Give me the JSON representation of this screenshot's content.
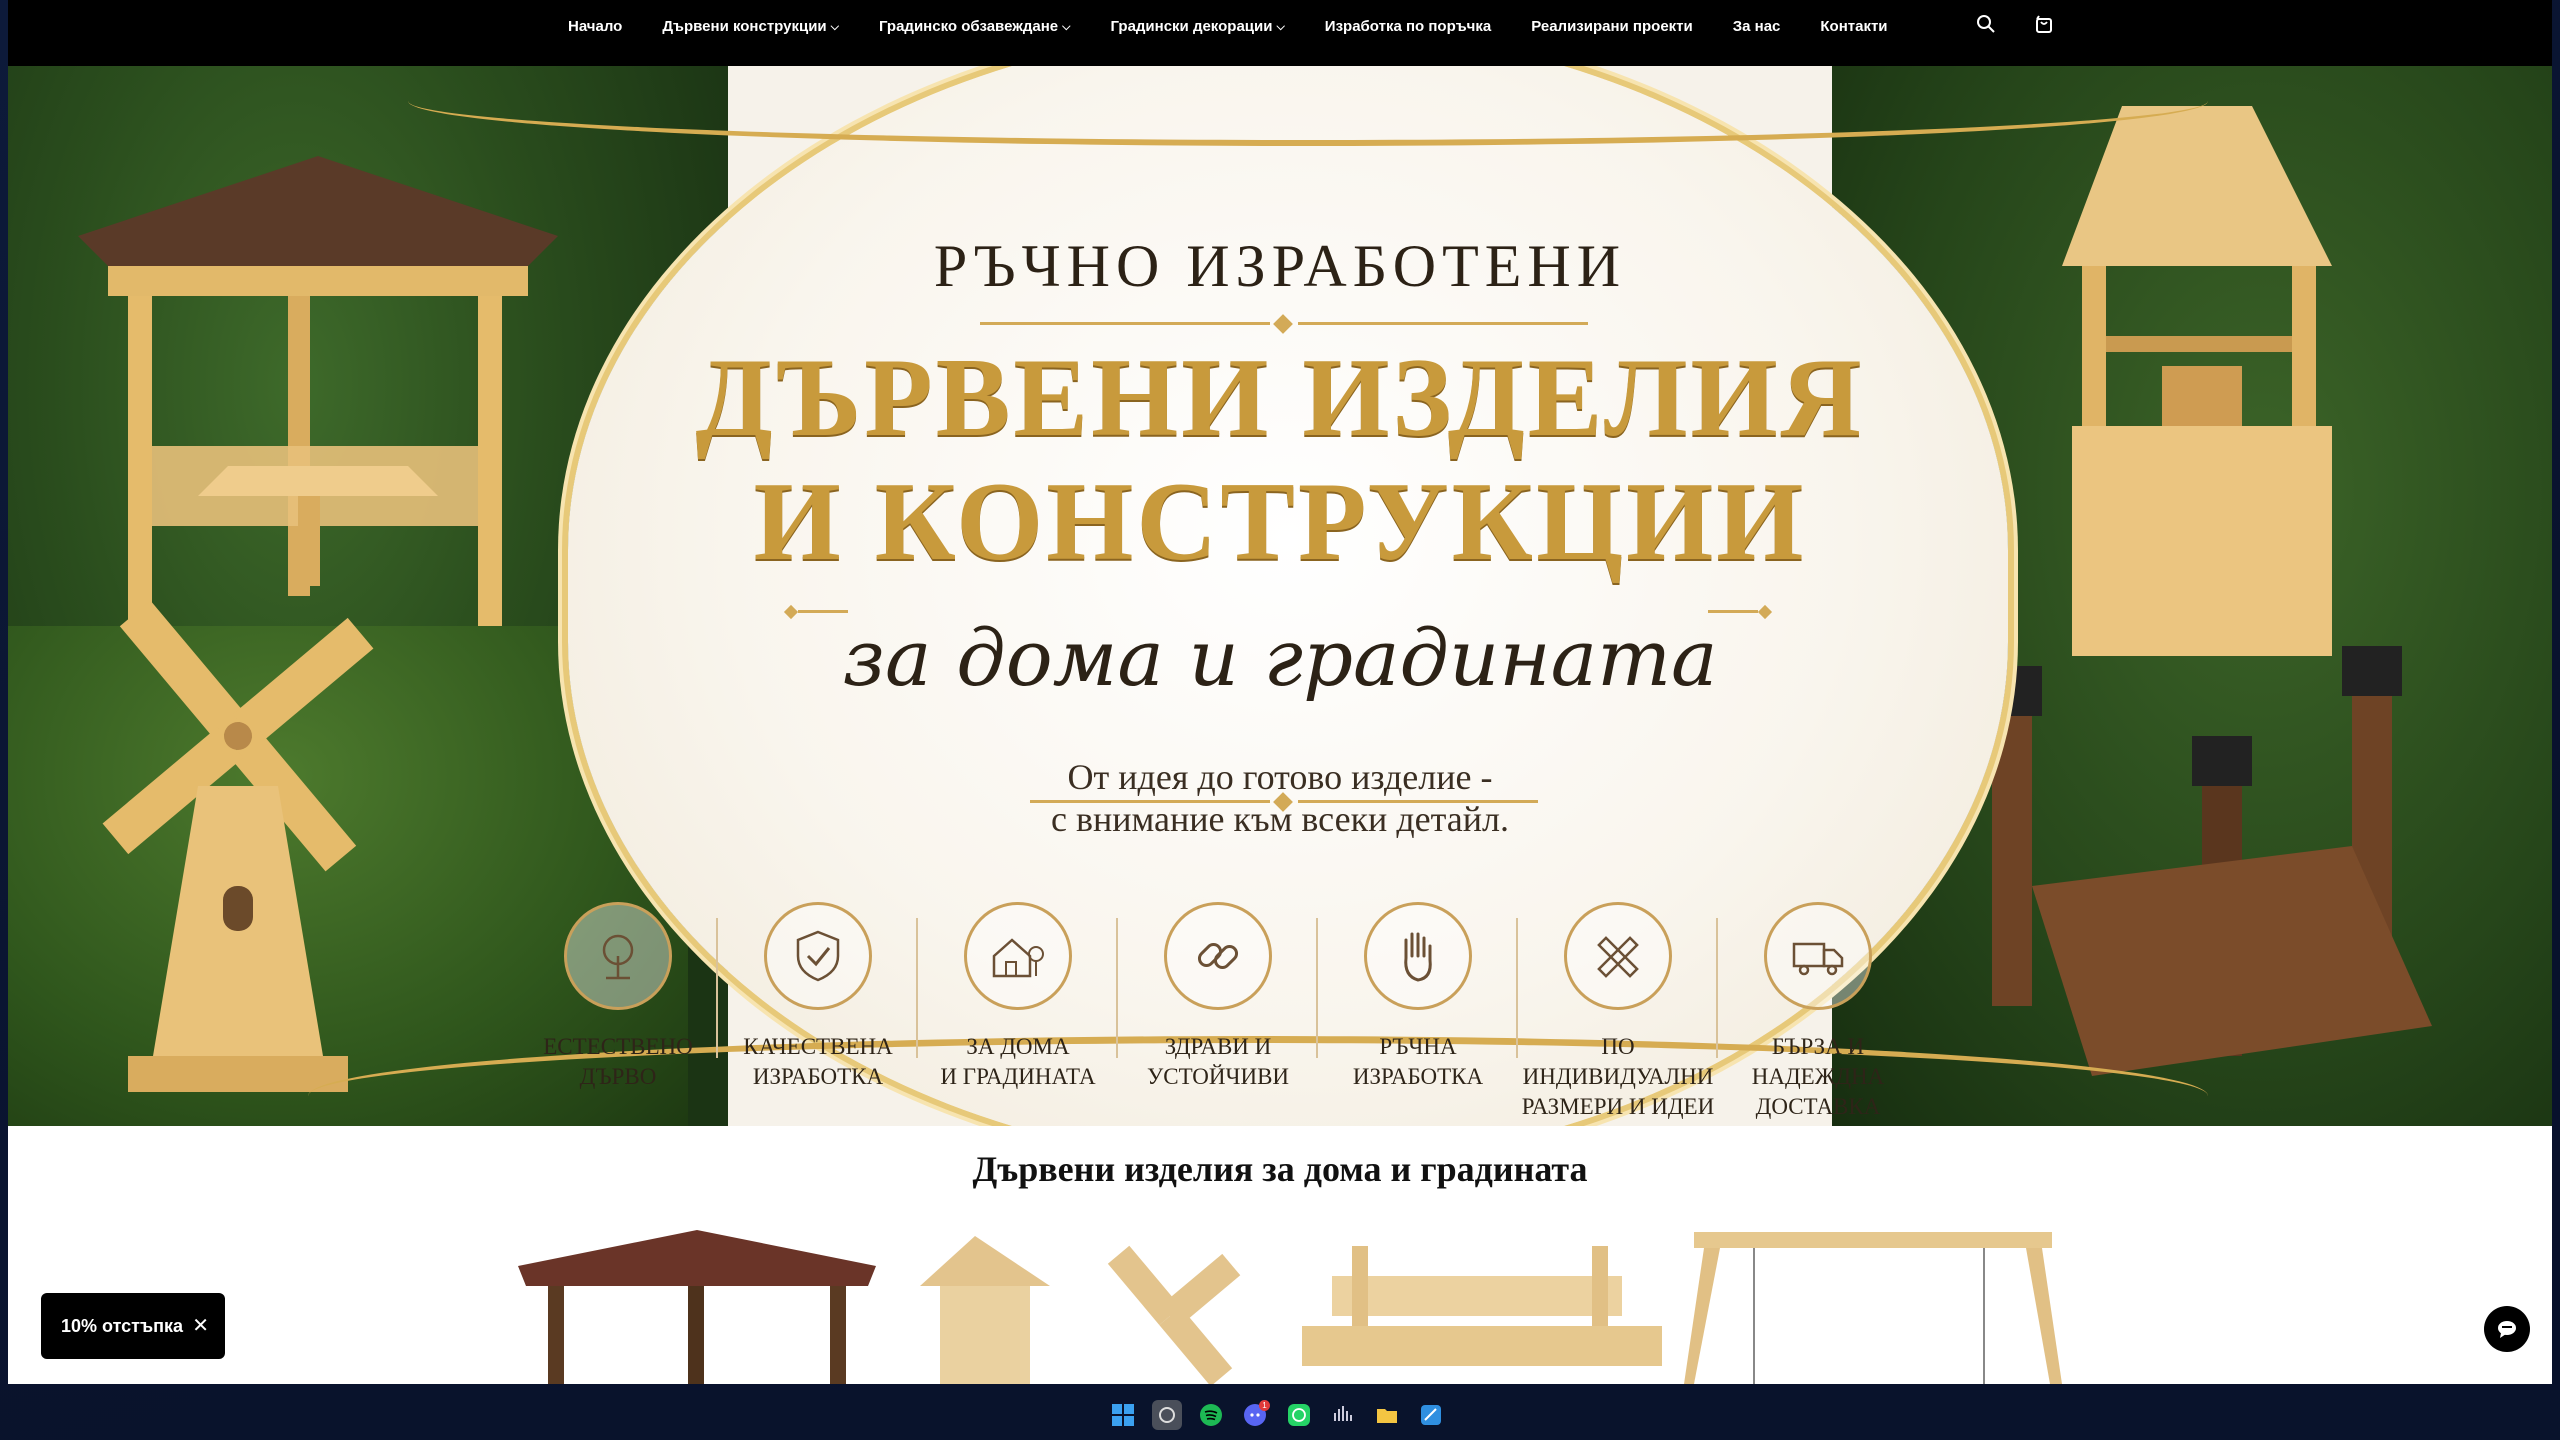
{
  "nav": {
    "items": [
      {
        "label": "Начало",
        "has_dropdown": false
      },
      {
        "label": "Дървени конструкции",
        "has_dropdown": true
      },
      {
        "label": "Градинско обзавеждане",
        "has_dropdown": true
      },
      {
        "label": "Градински декорации",
        "has_dropdown": true
      },
      {
        "label": "Изработка по поръчка",
        "has_dropdown": false
      },
      {
        "label": "Реализирани проекти",
        "has_dropdown": false
      },
      {
        "label": "За нас",
        "has_dropdown": false
      },
      {
        "label": "Контакти",
        "has_dropdown": false
      }
    ],
    "icons": [
      "search-icon",
      "cart-icon"
    ]
  },
  "hero": {
    "title_small": "РЪЧНО ИЗРАБОТЕНИ",
    "title_line1": "ДЪРВЕНИ ИЗДЕЛИЯ",
    "title_line2": "И КОНСТРУКЦИИ",
    "title_script": "за дома и градината",
    "subtitle_line1": "От идея до готово изделие -",
    "subtitle_line2": "с внимание към всеки детайл.",
    "features": [
      {
        "icon": "tree-icon",
        "label": "ЕСТЕСТВЕНО\nДЪРВО"
      },
      {
        "icon": "shield-check-icon",
        "label": "КАЧЕСТВЕНА\nИЗРАБОТКА"
      },
      {
        "icon": "house-tree-icon",
        "label": "ЗА ДОМА\nИ ГРАДИНАТА"
      },
      {
        "icon": "chain-link-icon",
        "label": "ЗДРАВИ И\nУСТОЙЧИВИ"
      },
      {
        "icon": "hand-icon",
        "label": "РЪЧНА\nИЗРАБОТКА"
      },
      {
        "icon": "ruler-pencil-icon",
        "label": "ПО ИНДИВИДУАЛНИ\nРАЗМЕРИ И ИДЕИ"
      },
      {
        "icon": "truck-icon",
        "label": "БЪРЗА И\nНАДЕЖДНА\nДОСТАВКА"
      }
    ],
    "colors": {
      "gold": "#c89a3c",
      "cream": "#f6f2ea",
      "dark_text": "#2c2216"
    }
  },
  "section": {
    "title": "Дървени изделия за дома и градината",
    "products": [
      "gazebo-image",
      "well-windmill-image",
      "bench-image",
      "swing-image"
    ]
  },
  "popup": {
    "discount_label": "10% отстъпка"
  },
  "taskbar": {
    "icons": [
      "windows-start-icon",
      "app-icon",
      "spotify-icon",
      "discord-icon",
      "whatsapp-icon",
      "audio-icon",
      "files-icon",
      "app-blue-icon"
    ],
    "discord_badge": "1"
  }
}
